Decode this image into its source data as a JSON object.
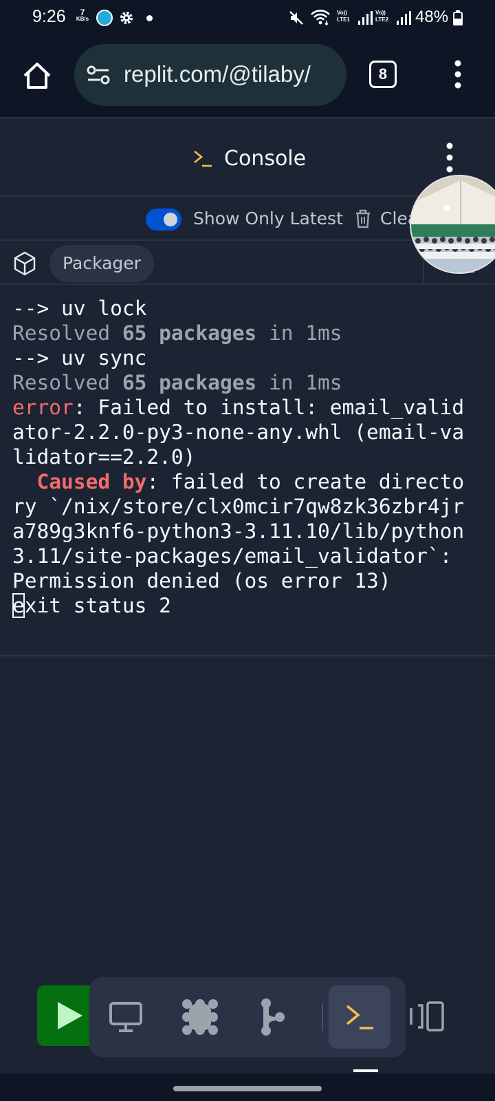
{
  "status_bar": {
    "time": "9:26",
    "net_speed_value": "7",
    "net_speed_unit": "KB/s",
    "sim1_label": "Vo))\nLTE1",
    "sim2_label": "Vo))\nLTE2",
    "battery_percent": "48%"
  },
  "browser": {
    "url": "replit.com/@tilaby/",
    "tab_count": "8"
  },
  "console": {
    "title": "Console",
    "toggle_label": "Show Only Latest",
    "toggle_on": true,
    "clear_label": "Clear",
    "tab_label": "Packager"
  },
  "output": {
    "line1": "--> uv lock",
    "line2_a": "Resolved ",
    "line2_b": "65 packages",
    "line2_c": " in 1ms",
    "line3": "--> uv sync",
    "line4_a": "Resolved ",
    "line4_b": "65 packages",
    "line4_c": " in 1ms",
    "error_word": "error",
    "error_rest": ": Failed to install: email_valid\nator-2.2.0-py3-none-any.whl (email-va\nlidator==2.2.0)",
    "cause_indent": "  ",
    "cause_word": "Caused by",
    "cause_rest": ": failed to create directo\nry `/nix/store/clx0mcir7qw8zk36zbr4jr\na789g3knf6-python3-3.11.10/lib/python\n3.11/site-packages/email_validator`:\nPermission denied (os error 13)",
    "exit_first_char": "e",
    "exit_rest": "xit status 2"
  },
  "colors": {
    "background": "#1c2333",
    "error": "#f36b6b",
    "toggle": "#0053d1",
    "run_button": "#05700f",
    "prompt_accent": "#f5c048"
  },
  "icons": {
    "home": "home-icon",
    "site_settings": "tune-icon",
    "browser_menu": "more-vert-icon",
    "console_prompt": "terminal-prompt-icon",
    "console_menu": "more-vert-icon",
    "trash": "trash-icon",
    "packager": "cube-icon",
    "run": "play-icon",
    "webview": "monitor-icon",
    "packages": "dots-grid-icon",
    "git": "git-branch-icon",
    "console_tab": "terminal-prompt-icon",
    "split": "split-pane-icon"
  }
}
